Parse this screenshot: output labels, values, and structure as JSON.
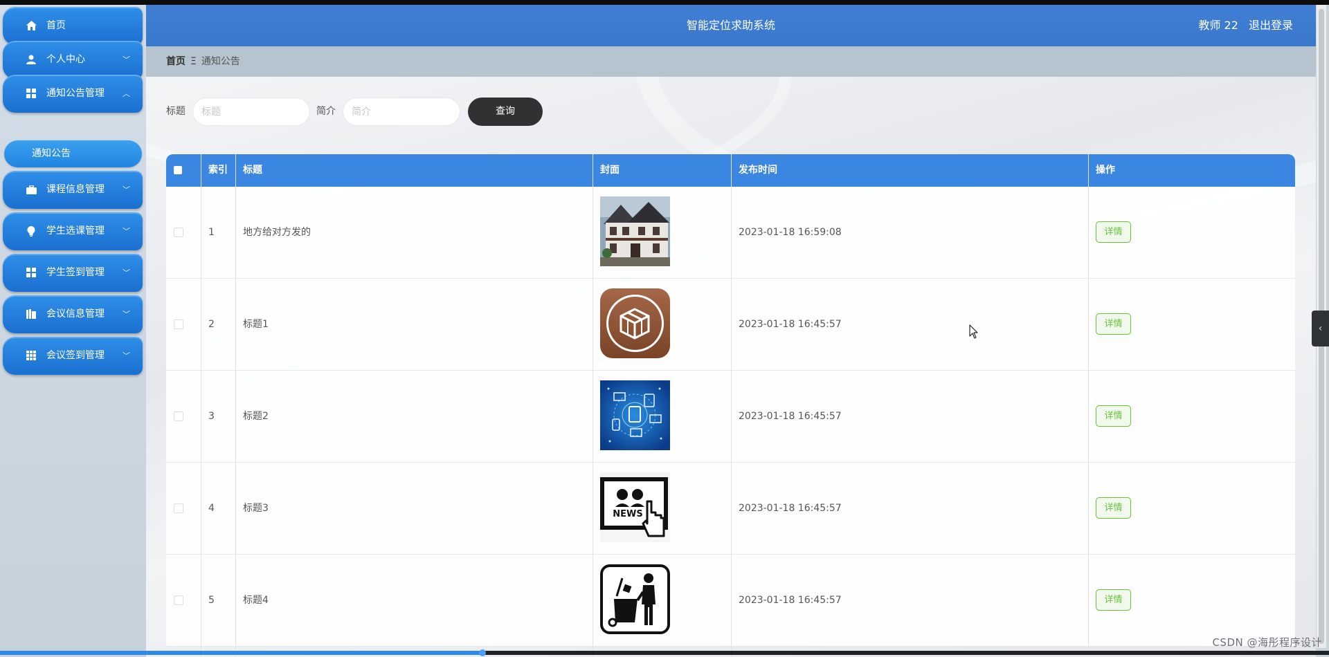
{
  "header": {
    "title": "智能定位求助系统",
    "user_name": "教师 22",
    "logout_label": "退出登录"
  },
  "sidebar": {
    "items": [
      {
        "label": "首页",
        "icon": "home-icon"
      },
      {
        "label": "个人中心",
        "icon": "user-icon",
        "chevron": "﹀"
      },
      {
        "label": "通知公告管理",
        "icon": "grid-icon",
        "chevron": "︿"
      },
      {
        "label": "课程信息管理",
        "icon": "briefcase-icon",
        "chevron": "﹀"
      },
      {
        "label": "学生选课管理",
        "icon": "bulb-icon",
        "chevron": "﹀"
      },
      {
        "label": "学生签到管理",
        "icon": "grid-icon",
        "chevron": "﹀"
      },
      {
        "label": "会议信息管理",
        "icon": "book-icon",
        "chevron": "﹀"
      },
      {
        "label": "会议签到管理",
        "icon": "apps-icon",
        "chevron": "﹀"
      }
    ],
    "submenu": {
      "label": "通知公告"
    }
  },
  "breadcrumb": {
    "home": "首页",
    "separator": "Ξ",
    "current": "通知公告"
  },
  "search": {
    "title_label": "标题",
    "title_placeholder": "标题",
    "intro_label": "简介",
    "intro_placeholder": "简介",
    "query_label": "查询"
  },
  "table": {
    "columns": [
      "索引",
      "标题",
      "封面",
      "发布时间",
      "操作"
    ],
    "rows": [
      {
        "index": "1",
        "title": "地方给对方发的",
        "cover": "house-photo",
        "time": "2023-01-18 16:59:08",
        "action": "详情"
      },
      {
        "index": "2",
        "title": "标题1",
        "cover": "package-app-icon",
        "time": "2023-01-18 16:45:57",
        "action": "详情"
      },
      {
        "index": "3",
        "title": "标题2",
        "cover": "network-devices-image",
        "time": "2023-01-18 16:45:57",
        "action": "详情"
      },
      {
        "index": "4",
        "title": "标题3",
        "cover": "news-tablet-icon",
        "time": "2023-01-18 16:45:57",
        "action": "详情"
      },
      {
        "index": "5",
        "title": "标题4",
        "cover": "recycling-bin-icon",
        "time": "2023-01-18 16:45:57",
        "action": "详情"
      }
    ]
  },
  "side_toggle": {
    "glyph": "‹"
  },
  "watermark": "CSDN @海彤程序设计",
  "video_progress": 0.363,
  "colors": {
    "header_blue": "#3f7fd3",
    "menu_blue": "#1b6fd0",
    "table_header": "#3a86e0",
    "detail_green": "#67c23a",
    "query_button": "#303133"
  }
}
